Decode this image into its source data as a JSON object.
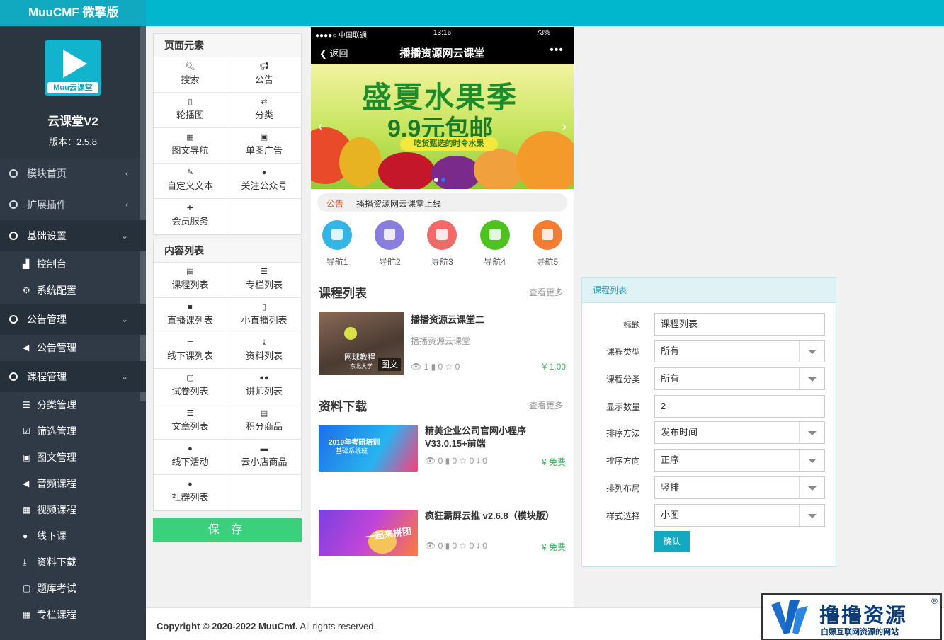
{
  "brand": "MuuCMF 微擎版",
  "sidebar": {
    "logo_text": "Muu云课堂",
    "title": "云课堂V2",
    "version": "版本：2.5.8",
    "menu": [
      {
        "label": "模块首页",
        "chevron": "‹"
      },
      {
        "label": "扩展插件",
        "chevron": "‹"
      },
      {
        "label": "基础设置",
        "chevron": "⌄"
      }
    ],
    "basic_sub": [
      {
        "label": "控制台",
        "icon": "chart-icon"
      },
      {
        "label": "系统配置",
        "icon": "gears-icon"
      }
    ],
    "notice_group": {
      "label": "公告管理",
      "chevron": "⌄"
    },
    "notice_sub": [
      {
        "label": "公告管理",
        "icon": "bullhorn-icon"
      }
    ],
    "course_group": {
      "label": "课程管理",
      "chevron": "⌄"
    },
    "course_sub": [
      {
        "label": "分类管理",
        "icon": "list-icon"
      },
      {
        "label": "筛选管理",
        "icon": "check-square-icon"
      },
      {
        "label": "图文管理",
        "icon": "image-icon"
      },
      {
        "label": "音频课程",
        "icon": "volume-icon"
      },
      {
        "label": "视频课程",
        "icon": "film-icon"
      },
      {
        "label": "线下课",
        "icon": "map-marker-icon"
      },
      {
        "label": "资料下载",
        "icon": "download-icon"
      },
      {
        "label": "题库考试",
        "icon": "square-icon"
      },
      {
        "label": "专栏课程",
        "icon": "grid-icon"
      }
    ]
  },
  "page_elements": {
    "title": "页面元素",
    "items": [
      "搜索",
      "公告",
      "轮播图",
      "分类",
      "图文导航",
      "单图广告",
      "自定义文本",
      "关注公众号",
      "会员服务"
    ]
  },
  "content_list": {
    "title": "内容列表",
    "items": [
      "课程列表",
      "专栏列表",
      "直播课列表",
      "小直播列表",
      "线下课列表",
      "资料列表",
      "试卷列表",
      "讲师列表",
      "文章列表",
      "积分商品",
      "线下活动",
      "云小店商品",
      "社群列表"
    ]
  },
  "save_label": "保 存",
  "phone": {
    "carrier": "●●●●○ 中国联通",
    "time": "13:16",
    "battery": "73%",
    "back_label": "返回",
    "title": "播播资源网云课堂",
    "banner": {
      "line1": "盛夏水果季",
      "line2": "9.9元包邮",
      "line3": "吃货甄选的时令水果"
    },
    "notice_tag": "公告",
    "notice_text": "播播资源网云课堂上线",
    "navs": [
      {
        "label": "导航1",
        "color": "#33b5e5"
      },
      {
        "label": "导航2",
        "color": "#8a7de0"
      },
      {
        "label": "导航3",
        "color": "#f06a6a"
      },
      {
        "label": "导航4",
        "color": "#4cc31f"
      },
      {
        "label": "导航5",
        "color": "#f57c33"
      }
    ],
    "course_section": {
      "title": "课程列表",
      "more": "查看更多"
    },
    "course": {
      "name": "播播资源云课堂二",
      "subtitle": "播播资源云课堂",
      "thumb_text": "网球教程",
      "thumb_sub": "东北大学",
      "badge": "图文",
      "stats": "👁 1  ▮ 0  ☆ 0",
      "price": "¥ 1.00"
    },
    "res_section": {
      "title": "资料下载",
      "more": "查看更多"
    },
    "resources": [
      {
        "name": "精美企业公司官网小程序V33.0.15+前端",
        "stats": "👁 0  ▮ 0  ☆ 0  ⤓ 0",
        "price": "¥ 免费",
        "thumb_text": "2019年考研培训",
        "thumb_sub": "基础系统班"
      },
      {
        "name": "疯狂霸屏云推 v2.6.8（模块版）",
        "stats": "👁 0  ▮ 0  ☆ 0  ⤓ 0",
        "price": "¥ 免费",
        "thumb_text": "一起来拼团",
        "thumb_sub": ""
      }
    ]
  },
  "form": {
    "title": "课程列表",
    "fields": [
      {
        "label": "标题",
        "value": "课程列表",
        "type": "input"
      },
      {
        "label": "课程类型",
        "value": "所有",
        "type": "select"
      },
      {
        "label": "课程分类",
        "value": "所有",
        "type": "select"
      },
      {
        "label": "显示数量",
        "value": "2",
        "type": "input"
      },
      {
        "label": "排序方法",
        "value": "发布时间",
        "type": "select"
      },
      {
        "label": "排序方向",
        "value": "正序",
        "type": "select"
      },
      {
        "label": "排列布局",
        "value": "竖排",
        "type": "select"
      },
      {
        "label": "样式选择",
        "value": "小图",
        "type": "select"
      }
    ],
    "confirm_label": "确认"
  },
  "footer": {
    "copyright": "Copyright © 2020-2022 MuuCmf.",
    "rights": " All rights reserved."
  },
  "watermark": {
    "title": "撸撸资源",
    "subtitle": "白嫖互联网资源的网站",
    "reg": "®"
  }
}
